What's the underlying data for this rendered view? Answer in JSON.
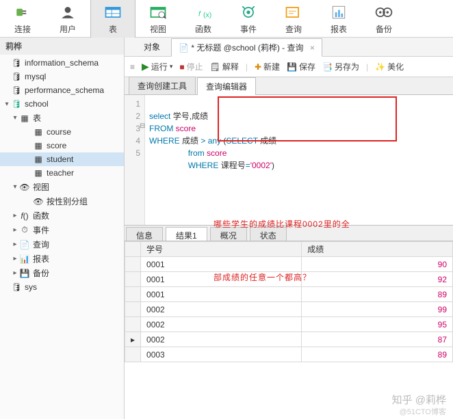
{
  "toolbar_main": {
    "connect": "连接",
    "user": "用户",
    "table": "表",
    "view": "视图",
    "function": "函数",
    "event": "事件",
    "query": "查询",
    "report": "报表",
    "backup": "备份"
  },
  "sidebar": {
    "connection_name": "莉桦",
    "databases": {
      "information_schema": "information_schema",
      "mysql": "mysql",
      "performance_schema": "performance_schema",
      "school": "school",
      "sys": "sys"
    },
    "nodes": {
      "tables": "表",
      "views": "视图",
      "functions": "函数",
      "events": "事件",
      "queries": "查询",
      "reports": "报表",
      "backups": "备份",
      "by_attr_group": "按性别分组"
    },
    "tables": {
      "course": "course",
      "score": "score",
      "student": "student",
      "teacher": "teacher"
    }
  },
  "tabs1": {
    "objects": "对象",
    "query_tab": "* 无标题 @school (莉桦) - 查询"
  },
  "toolbar2": {
    "run": "运行",
    "stop": "停止",
    "explain": "解释",
    "new": "新建",
    "save": "保存",
    "save_as": "另存为",
    "beautify": "美化"
  },
  "tabs2": {
    "builder": "查询创建工具",
    "editor": "查询编辑器"
  },
  "sql": {
    "line1_kw": "select",
    "line1_cols": " 学号,成绩",
    "line2_kw": "FROM",
    "line2_tbl": " score",
    "line3_kw": "WHERE",
    "line3_col": " 成绩 ",
    "line3_op": ">",
    "line3_any": " any ",
    "line3_sub_kw": "SELECT",
    "line3_sub_col": " 成绩",
    "line4_kw": "from",
    "line4_tbl": " score",
    "line5_kw": "WHERE",
    "line5_col": " 课程号",
    "line5_eq": "=",
    "line5_str": "'0002'"
  },
  "gutter": [
    "1",
    "2",
    "3",
    "4",
    "5"
  ],
  "annotation": {
    "line1": "哪些学生的成绩比课程0002里的全",
    "line2": "部成绩的任意一个都高？"
  },
  "tabs3": {
    "info": "信息",
    "result1": "结果1",
    "overview": "概况",
    "status": "状态"
  },
  "grid": {
    "headers": {
      "col1": "学号",
      "col2": "成绩"
    },
    "rows": [
      {
        "id": "0001",
        "score": 90
      },
      {
        "id": "0001",
        "score": 92
      },
      {
        "id": "0001",
        "score": 89
      },
      {
        "id": "0002",
        "score": 99
      },
      {
        "id": "0002",
        "score": 95
      },
      {
        "id": "0002",
        "score": 87,
        "current": true
      },
      {
        "id": "0003",
        "score": 89
      }
    ]
  },
  "watermark": {
    "top": "知乎 @莉桦",
    "bottom": "@51CTO博客"
  }
}
